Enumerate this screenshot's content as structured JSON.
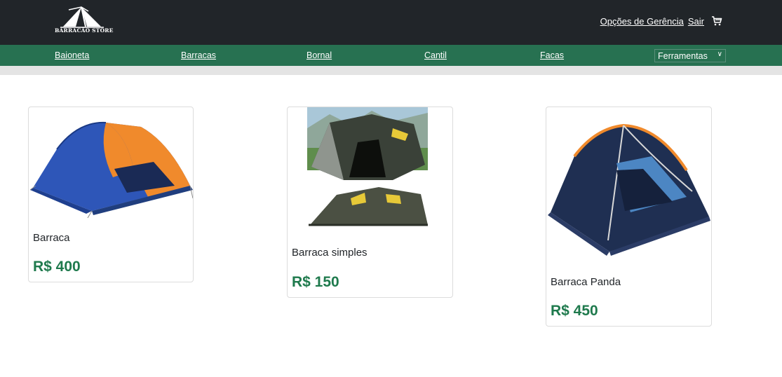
{
  "brand": {
    "name": "BARRACÃO STORE",
    "logo_icon": "tent-logo-icon"
  },
  "header": {
    "links": [
      "Opções de Gerência",
      "Sair"
    ],
    "cart_icon": "cart-icon"
  },
  "nav": {
    "items": [
      "Baioneta",
      "Barracas",
      "Bornal",
      "Cantil",
      "Facas"
    ],
    "select": {
      "value": "Ferramentas",
      "icon": "chevron-down-icon"
    }
  },
  "colors": {
    "topbar": "#212529",
    "navbar": "#277151",
    "price": "#1f7a4d"
  },
  "products": [
    {
      "name": "Barraca",
      "price": "R$ 400",
      "image": "blue-orange-dome-tent"
    },
    {
      "name": "Barraca simples",
      "price": "R$ 150",
      "image": "green-tunnel-tent"
    },
    {
      "name": "Barraca Panda",
      "price": "R$ 450",
      "image": "navy-orange-dome-tent"
    }
  ]
}
